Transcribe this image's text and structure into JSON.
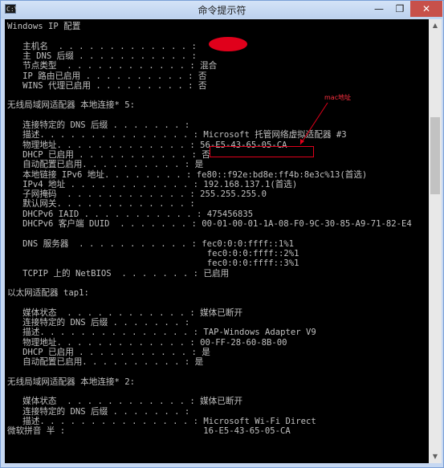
{
  "window": {
    "title": "命令提示符",
    "app_icon": "C:\\",
    "min_glyph": "—",
    "max_glyph": "❐",
    "close_glyph": "✕"
  },
  "console": {
    "lines": [
      "Windows IP 配置",
      "",
      "   主机名  . . . . . . . . . . . . . :",
      "   主 DNS 后缀 . . . . . . . . . . . :",
      "   节点类型  . . . . . . . . . . . . : 混合",
      "   IP 路由已启用 . . . . . . . . . . : 否",
      "   WINS 代理已启用 . . . . . . . . . : 否",
      "",
      "无线局域网适配器 本地连接* 5:",
      "",
      "   连接特定的 DNS 后缀 . . . . . . . :",
      "   描述. . . . . . . . . . . . . . . : Microsoft 托管网络虚拟适配器 #3",
      "   物理地址. . . . . . . . . . . . . : 56-E5-43-65-05-CA",
      "   DHCP 已启用 . . . . . . . . . . . : 否",
      "   自动配置已启用. . . . . . . . . . : 是",
      "   本地链接 IPv6 地址. . . . . . . . : fe80::f92e:bd8e:ff4b:8e3c%13(首选)",
      "   IPv4 地址 . . . . . . . . . . . . : 192.168.137.1(首选)",
      "   子网掩码  . . . . . . . . . . . . : 255.255.255.0",
      "   默认网关. . . . . . . . . . . . . :",
      "   DHCPv6 IAID . . . . . . . . . . . : 475456835",
      "   DHCPv6 客户端 DUID  . . . . . . . : 00-01-00-01-1A-08-F0-9C-30-85-A9-71-82-E4",
      "",
      "   DNS 服务器  . . . . . . . . . . . : fec0:0:0:ffff::1%1",
      "                                       fec0:0:0:ffff::2%1",
      "                                       fec0:0:0:ffff::3%1",
      "   TCPIP 上的 NetBIOS  . . . . . . . : 已启用",
      "",
      "以太网适配器 tap1:",
      "",
      "   媒体状态  . . . . . . . . . . . . : 媒体已断开",
      "   连接特定的 DNS 后缀 . . . . . . . :",
      "   描述. . . . . . . . . . . . . . . : TAP-Windows Adapter V9",
      "   物理地址. . . . . . . . . . . . . : 00-FF-28-60-8B-00",
      "   DHCP 已启用 . . . . . . . . . . . : 是",
      "   自动配置已启用. . . . . . . . . . : 是",
      "",
      "无线局域网适配器 本地连接* 2:",
      "",
      "   媒体状态  . . . . . . . . . . . . : 媒体已断开",
      "   连接特定的 DNS 后缀 . . . . . . . :",
      "   描述. . . . . . . . . . . . . . . : Microsoft Wi-Fi Direct",
      "微软拼音 半 :                           16-E5-43-65-05-CA"
    ]
  },
  "annotation": {
    "label": "mac地址",
    "color": "#e0001b"
  },
  "scrollbar": {
    "up_glyph": "▲",
    "down_glyph": "▼"
  }
}
